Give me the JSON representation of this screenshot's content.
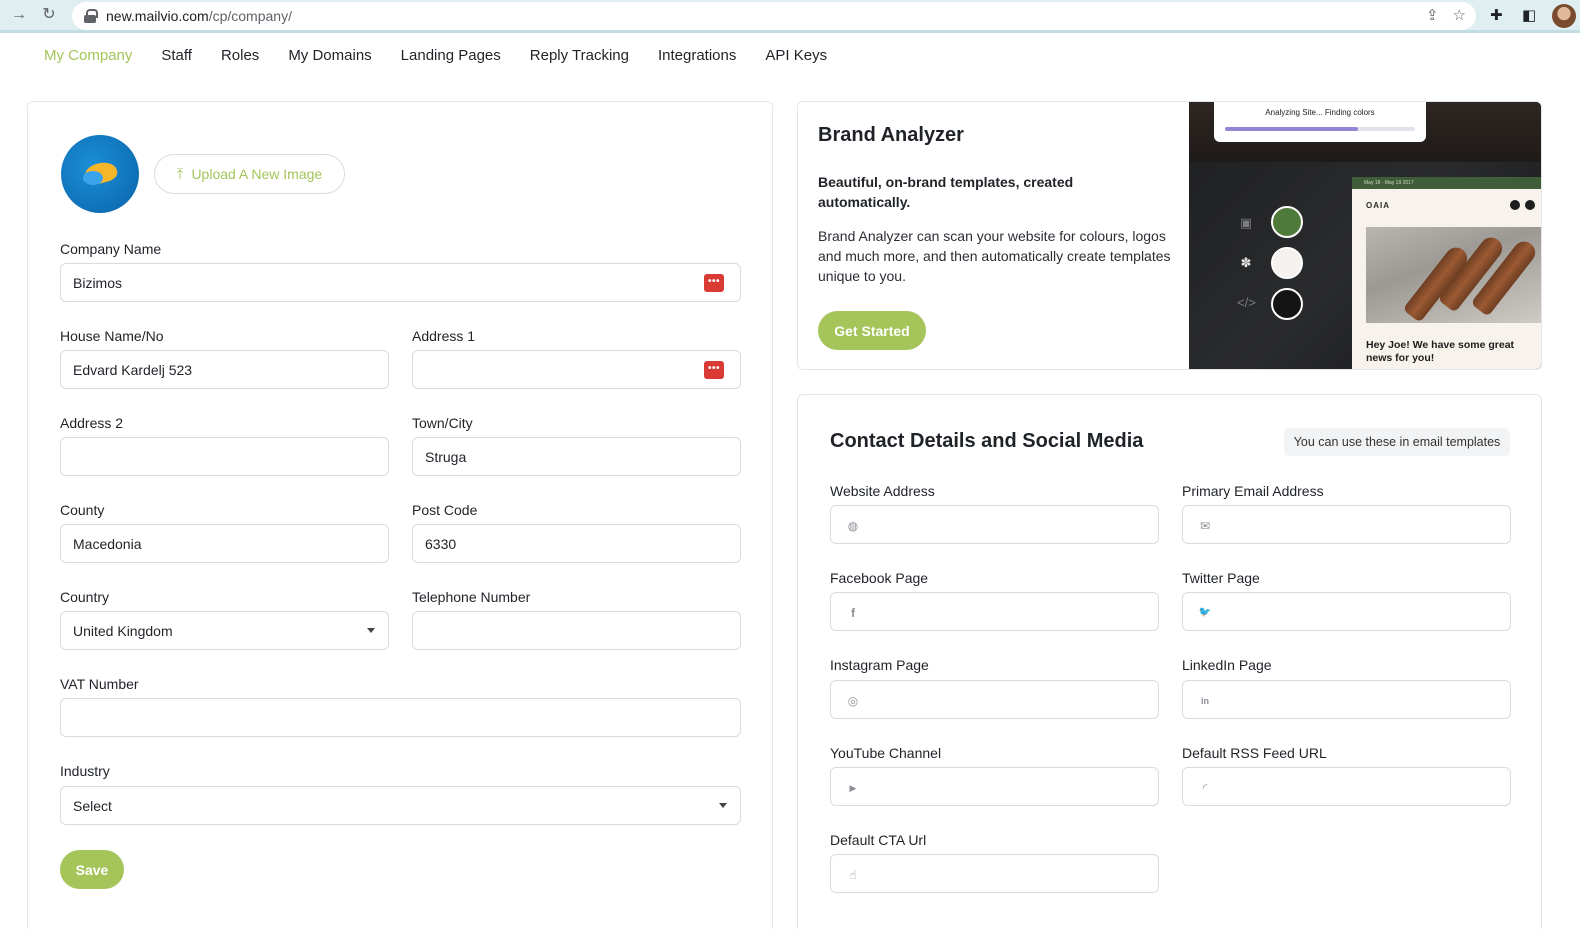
{
  "browser": {
    "url_host": "new.mailvio.com",
    "url_path": "/cp/company/"
  },
  "tabs": [
    {
      "label": "My Company",
      "active": true
    },
    {
      "label": "Staff"
    },
    {
      "label": "Roles"
    },
    {
      "label": "My Domains"
    },
    {
      "label": "Landing Pages"
    },
    {
      "label": "Reply Tracking"
    },
    {
      "label": "Integrations"
    },
    {
      "label": "API Keys"
    }
  ],
  "company_form": {
    "upload_label": "Upload A New Image",
    "company_name": {
      "label": "Company Name",
      "value": "Bizimos"
    },
    "house": {
      "label": "House Name/No",
      "value": "Edvard Kardelj 523"
    },
    "address1": {
      "label": "Address 1",
      "value": ""
    },
    "address2": {
      "label": "Address 2",
      "value": ""
    },
    "town": {
      "label": "Town/City",
      "value": "Struga"
    },
    "county": {
      "label": "County",
      "value": "Macedonia"
    },
    "postcode": {
      "label": "Post Code",
      "value": "6330"
    },
    "country": {
      "label": "Country",
      "value": "United Kingdom"
    },
    "telephone": {
      "label": "Telephone Number",
      "value": ""
    },
    "vat": {
      "label": "VAT Number",
      "value": ""
    },
    "industry": {
      "label": "Industry",
      "value": "Select"
    },
    "save_label": "Save",
    "pw_badge": "•••"
  },
  "brand_analyzer": {
    "title": "Brand Analyzer",
    "subtitle": "Beautiful, on-brand templates, created automatically.",
    "description": "Brand Analyzer can scan your website for colours, logos and much more, and then automatically create templates unique to you.",
    "button": "Get Started",
    "preview": {
      "analyzing_text": "Analyzing Site... Finding colors",
      "progress": 0.7,
      "swatches": [
        "#4e7a3a",
        "#f4f1ee",
        "#141414"
      ],
      "email_bar_text": "May 18 - May 19 2017",
      "email_logo": "OAIA",
      "email_text": "Hey Joe! We have some great news for you!"
    }
  },
  "contact": {
    "title": "Contact Details and Social Media",
    "badge": "You can use these in email templates",
    "fields": [
      {
        "label": "Website Address",
        "icon": "globe-icon",
        "glyph": "◍",
        "value": ""
      },
      {
        "label": "Primary Email Address",
        "icon": "envelope-icon",
        "glyph": "✉",
        "value": ""
      },
      {
        "label": "Facebook Page",
        "icon": "facebook-icon",
        "glyph": "f",
        "value": ""
      },
      {
        "label": "Twitter Page",
        "icon": "twitter-icon",
        "glyph": "🐦",
        "value": ""
      },
      {
        "label": "Instagram Page",
        "icon": "instagram-icon",
        "glyph": "◎",
        "value": ""
      },
      {
        "label": "LinkedIn Page",
        "icon": "linkedin-icon",
        "glyph": "in",
        "value": ""
      },
      {
        "label": "YouTube Channel",
        "icon": "youtube-icon",
        "glyph": "▶",
        "value": ""
      },
      {
        "label": "Default RSS Feed URL",
        "icon": "rss-icon",
        "glyph": "◜",
        "value": ""
      },
      {
        "label": "Default CTA Url",
        "icon": "pointer-hand-icon",
        "glyph": "☝",
        "value": ""
      }
    ]
  },
  "colors": {
    "accent": "#a5c45a",
    "password_badge": "#d93a34"
  }
}
